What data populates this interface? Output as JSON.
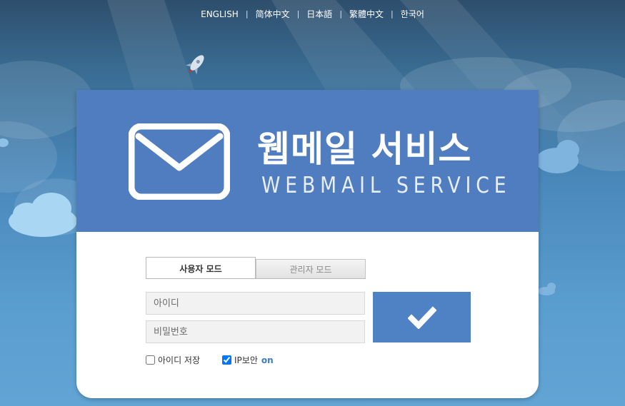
{
  "languages": [
    {
      "label": "ENGLISH"
    },
    {
      "label": "简体中文"
    },
    {
      "label": "日本語"
    },
    {
      "label": "繁體中文"
    },
    {
      "label": "한국어"
    }
  ],
  "header": {
    "title_ko": "웹메일 서비스",
    "title_en": "WEBMAIL SERVICE",
    "icon": "envelope-icon"
  },
  "tabs": [
    {
      "label": "사용자 모드",
      "active": true
    },
    {
      "label": "관리자 모드",
      "active": false
    }
  ],
  "form": {
    "id_placeholder": "아이디",
    "pw_placeholder": "비밀번호",
    "submit_icon": "checkmark-icon",
    "save_id_label": "아이디 저장",
    "save_id_checked": false,
    "ip_security_label": "IP보안",
    "ip_security_state": "on",
    "ip_security_checked": true
  },
  "colors": {
    "header_bg": "#4f7dbf",
    "button_bg": "#4e82c5",
    "on_text": "#3a7bc8"
  }
}
